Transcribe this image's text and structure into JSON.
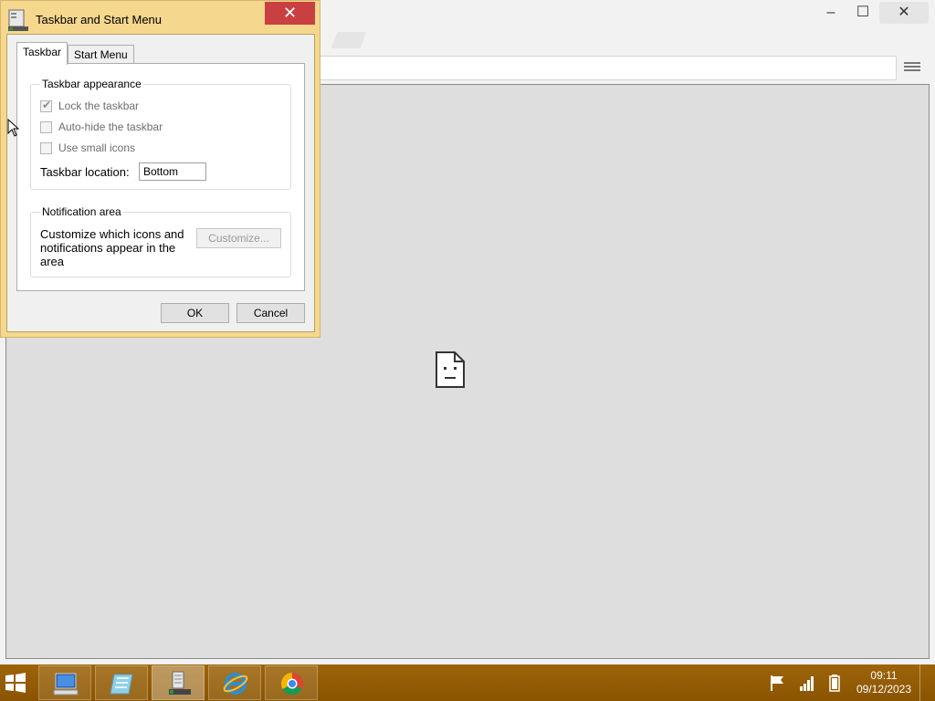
{
  "dialog": {
    "title": "Taskbar and Start Menu",
    "close_glyph": "✕",
    "tabs": [
      {
        "label": "Taskbar",
        "active": true
      },
      {
        "label": "Start Menu",
        "active": false
      }
    ],
    "appearance": {
      "legend": "Taskbar appearance",
      "options": [
        {
          "label": "Lock the taskbar",
          "checked": true,
          "enabled": false
        },
        {
          "label": "Auto-hide the taskbar",
          "checked": false,
          "enabled": false
        },
        {
          "label": "Use small icons",
          "checked": false,
          "enabled": false
        }
      ],
      "location_label": "Taskbar location:",
      "location_value": "Bottom"
    },
    "notification": {
      "legend": "Notification area",
      "text": "Customize which icons and notifications appear in the area",
      "customize_label": "Customize..."
    },
    "ok_label": "OK",
    "cancel_label": "Cancel"
  },
  "browser": {
    "tab_close_glyph": "‹",
    "error_icon": "sad-file-icon"
  },
  "taskbar": {
    "items": [
      {
        "name": "computer-icon",
        "active": false
      },
      {
        "name": "notepad-icon",
        "active": false
      },
      {
        "name": "server-manager-icon",
        "active": true
      },
      {
        "name": "internet-explorer-icon",
        "active": false
      },
      {
        "name": "chrome-icon",
        "active": false
      }
    ],
    "clock_time": "09:11",
    "clock_date": "09/12/2023",
    "tray_icons": [
      "flag-icon",
      "network-icon",
      "battery-icon"
    ]
  }
}
